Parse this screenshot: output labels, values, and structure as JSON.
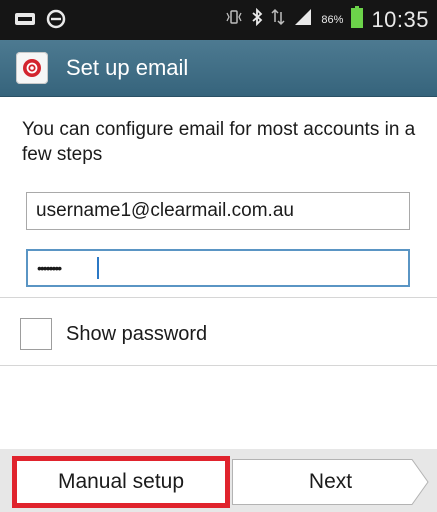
{
  "status_bar": {
    "battery_percent": "86%",
    "time": "10:35",
    "icons": [
      "voicemail-icon",
      "do-not-disturb-icon",
      "vibrate-icon",
      "bluetooth-icon",
      "data-transfer-icon",
      "signal-icon",
      "battery-icon"
    ]
  },
  "title_bar": {
    "app_icon": "email-app-icon",
    "title": "Set up email"
  },
  "form": {
    "intro": "You can configure email for most accounts in a few steps",
    "email_value": "username1@clearmail.com.au",
    "password_value": "••••••••",
    "show_password_label": "Show password",
    "show_password_checked": false
  },
  "buttons": {
    "manual_setup": "Manual setup",
    "next": "Next"
  },
  "colors": {
    "title_bar": "#3f6e86",
    "highlight": "#e0232d",
    "focus_border": "#5a95c4",
    "battery": "#6cd34a"
  }
}
